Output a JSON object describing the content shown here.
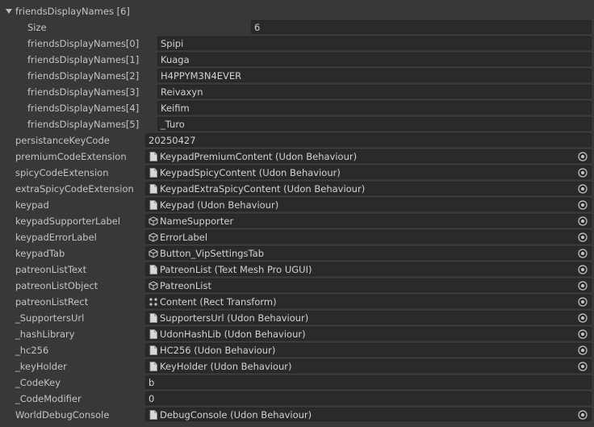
{
  "array": {
    "header": "friendsDisplayNames [6]",
    "size_label": "Size",
    "size_value": "6",
    "elements": [
      {
        "label": "friendsDisplayNames[0]",
        "value": "Spipi"
      },
      {
        "label": "friendsDisplayNames[1]",
        "value": "Kuaga"
      },
      {
        "label": "friendsDisplayNames[2]",
        "value": "H4PPYM3N4EVER"
      },
      {
        "label": "friendsDisplayNames[3]",
        "value": "Reivaxyn"
      },
      {
        "label": "friendsDisplayNames[4]",
        "value": "Keifim"
      },
      {
        "label": "friendsDisplayNames[5]",
        "value": "_Turo"
      }
    ]
  },
  "fields": [
    {
      "label": "persistanceKeyCode",
      "value": "20250427",
      "icon": "",
      "picker": false
    },
    {
      "label": "premiumCodeExtension",
      "value": "KeypadPremiumContent (Udon Behaviour)",
      "icon": "script-icon",
      "picker": true
    },
    {
      "label": "spicyCodeExtension",
      "value": "KeypadSpicyContent (Udon Behaviour)",
      "icon": "script-icon",
      "picker": true
    },
    {
      "label": "extraSpicyCodeExtension",
      "value": "KeypadExtraSpicyContent (Udon Behaviour)",
      "icon": "script-icon",
      "picker": true
    },
    {
      "label": "keypad",
      "value": "Keypad (Udon Behaviour)",
      "icon": "script-icon",
      "picker": true
    },
    {
      "label": "keypadSupporterLabel",
      "value": "NameSupporter",
      "icon": "gameobject-icon",
      "picker": true
    },
    {
      "label": "keypadErrorLabel",
      "value": "ErrorLabel",
      "icon": "gameobject-icon",
      "picker": true
    },
    {
      "label": "keypadTab",
      "value": "Button_VipSettingsTab",
      "icon": "gameobject-icon",
      "picker": true
    },
    {
      "label": "patreonListText",
      "value": "PatreonList (Text Mesh Pro UGUI)",
      "icon": "script-icon",
      "picker": true
    },
    {
      "label": "patreonListObject",
      "value": "PatreonList",
      "icon": "gameobject-icon",
      "picker": true
    },
    {
      "label": "patreonListRect",
      "value": "Content (Rect Transform)",
      "icon": "recttransform-icon",
      "picker": true
    },
    {
      "label": "_SupportersUrl",
      "value": "SupportersUrl (Udon Behaviour)",
      "icon": "script-icon",
      "picker": true
    },
    {
      "label": "_hashLibrary",
      "value": "UdonHashLib (Udon Behaviour)",
      "icon": "script-icon",
      "picker": true
    },
    {
      "label": "_hc256",
      "value": "HC256 (Udon Behaviour)",
      "icon": "script-icon",
      "picker": true
    },
    {
      "label": "_keyHolder",
      "value": "KeyHolder (Udon Behaviour)",
      "icon": "script-icon",
      "picker": true
    },
    {
      "label": "_CodeKey",
      "value": "b",
      "icon": "",
      "picker": false
    },
    {
      "label": "_CodeModifier",
      "value": "0",
      "icon": "",
      "picker": false
    },
    {
      "label": "WorldDebugConsole",
      "value": "DebugConsole (Udon Behaviour)",
      "icon": "script-icon",
      "picker": true
    }
  ]
}
